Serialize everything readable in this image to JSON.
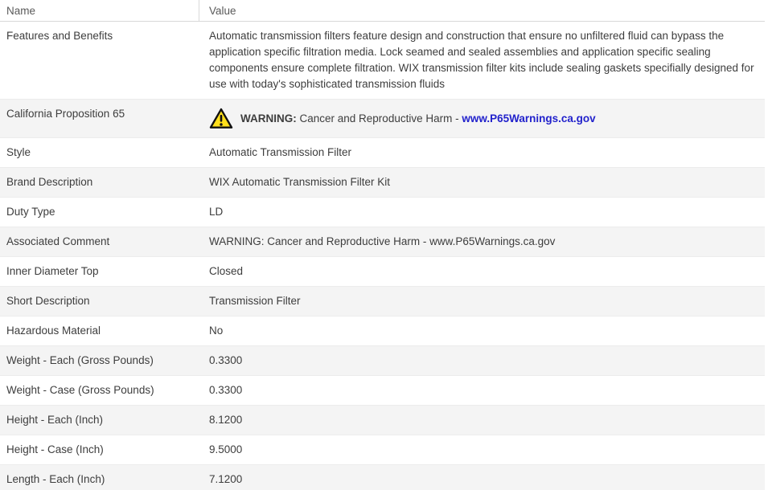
{
  "header": {
    "name_label": "Name",
    "value_label": "Value"
  },
  "colors": {
    "link_blue": "#2222cc",
    "stripe_gray": "#f4f4f4",
    "warning_yellow": "#ffdf1b",
    "warning_outline": "#111111",
    "body_text": "#3d3d3d",
    "header_text": "#595959"
  },
  "table": {
    "rows": [
      {
        "name": "Features and Benefits",
        "value": "Automatic transmission filters feature design and construction that ensure no unfiltered fluid can bypass the application specific filtration media. Lock seamed and sealed assemblies and application specific sealing components ensure complete filtration. WIX transmission filter kits include sealing gaskets specifially designed for use with today's sophisticated transmission fluids"
      },
      {
        "name": "California Proposition 65",
        "type": "warning",
        "icon": "warning-triangle-icon",
        "warning_label": "WARNING:",
        "warning_text": " Cancer and Reproductive Harm - ",
        "link_text": "www.P65Warnings.ca.gov"
      },
      {
        "name": "Style",
        "value": "Automatic Transmission Filter"
      },
      {
        "name": "Brand Description",
        "value": "WIX Automatic Transmission Filter Kit"
      },
      {
        "name": "Duty Type",
        "value": "LD"
      },
      {
        "name": "Associated Comment",
        "value": "WARNING: Cancer and Reproductive Harm - www.P65Warnings.ca.gov"
      },
      {
        "name": "Inner Diameter Top",
        "value": "Closed"
      },
      {
        "name": "Short Description",
        "value": "Transmission Filter"
      },
      {
        "name": "Hazardous Material",
        "value": "No"
      },
      {
        "name": "Weight - Each (Gross Pounds)",
        "value": "0.3300"
      },
      {
        "name": "Weight - Case (Gross Pounds)",
        "value": "0.3300"
      },
      {
        "name": "Height - Each (Inch)",
        "value": "8.1200"
      },
      {
        "name": "Height - Case (Inch)",
        "value": "9.5000"
      },
      {
        "name": "Length - Each (Inch)",
        "value": "7.1200"
      }
    ]
  }
}
